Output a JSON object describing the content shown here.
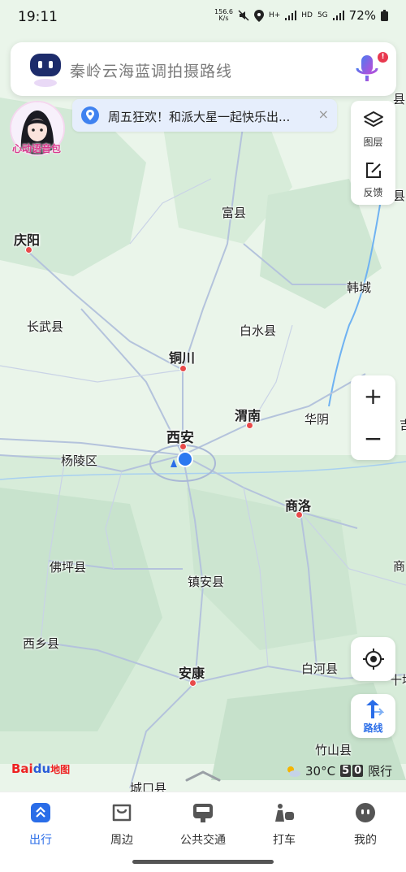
{
  "status_bar": {
    "time": "19:11",
    "net_speed_value": "156.6",
    "net_speed_unit": "K/s",
    "signal1_label": "H+",
    "signal1_sub": "R",
    "signal2_label": "HD",
    "signal3_label": "5G",
    "battery": "72%"
  },
  "search": {
    "placeholder_text": "秦岭云海蓝调拍摄路线",
    "mic_badge": "!"
  },
  "avatar": {
    "label": "心动语音包"
  },
  "promo": {
    "text": "周五狂欢！和派大星一起快乐出...",
    "close": "×"
  },
  "side_panel": {
    "layers_label": "图层",
    "feedback_label": "反馈"
  },
  "zoom": {
    "plus": "+",
    "minus": "−"
  },
  "route": {
    "label": "路线"
  },
  "logo": {
    "bai": "Bai",
    "du": "du",
    "map": "地图"
  },
  "weather": {
    "temp": "30°C",
    "restrict_digits": [
      "5",
      "0"
    ],
    "restrict_label": "限行"
  },
  "map": {
    "cities": [
      {
        "name": "庆阳"
      },
      {
        "name": "富县"
      },
      {
        "name": "韩城"
      },
      {
        "name": "长武县"
      },
      {
        "name": "白水县"
      },
      {
        "name": "铜川"
      },
      {
        "name": "渭南"
      },
      {
        "name": "华阴"
      },
      {
        "name": "西安"
      },
      {
        "name": "杨陵区"
      },
      {
        "name": "商洛"
      },
      {
        "name": "佛坪县"
      },
      {
        "name": "镇安县"
      },
      {
        "name": "西乡县"
      },
      {
        "name": "白河县"
      },
      {
        "name": "安康"
      },
      {
        "name": "竹山县"
      },
      {
        "name": "城口县"
      },
      {
        "name": "县"
      },
      {
        "name": "县"
      },
      {
        "name": "吉"
      },
      {
        "name": "商"
      },
      {
        "name": "十堰"
      }
    ]
  },
  "bottom_nav": {
    "items": [
      {
        "label": "出行",
        "active": true
      },
      {
        "label": "周边",
        "active": false
      },
      {
        "label": "公共交通",
        "active": false
      },
      {
        "label": "打车",
        "active": false
      },
      {
        "label": "我的",
        "active": false
      }
    ]
  },
  "colors": {
    "accent": "#2a6de8",
    "map_base": "#eaf5ea",
    "forest": "#cfe7d3",
    "road": "#b4c3dc",
    "river": "#6fb2f2",
    "city_dot": "#e84a4a"
  }
}
